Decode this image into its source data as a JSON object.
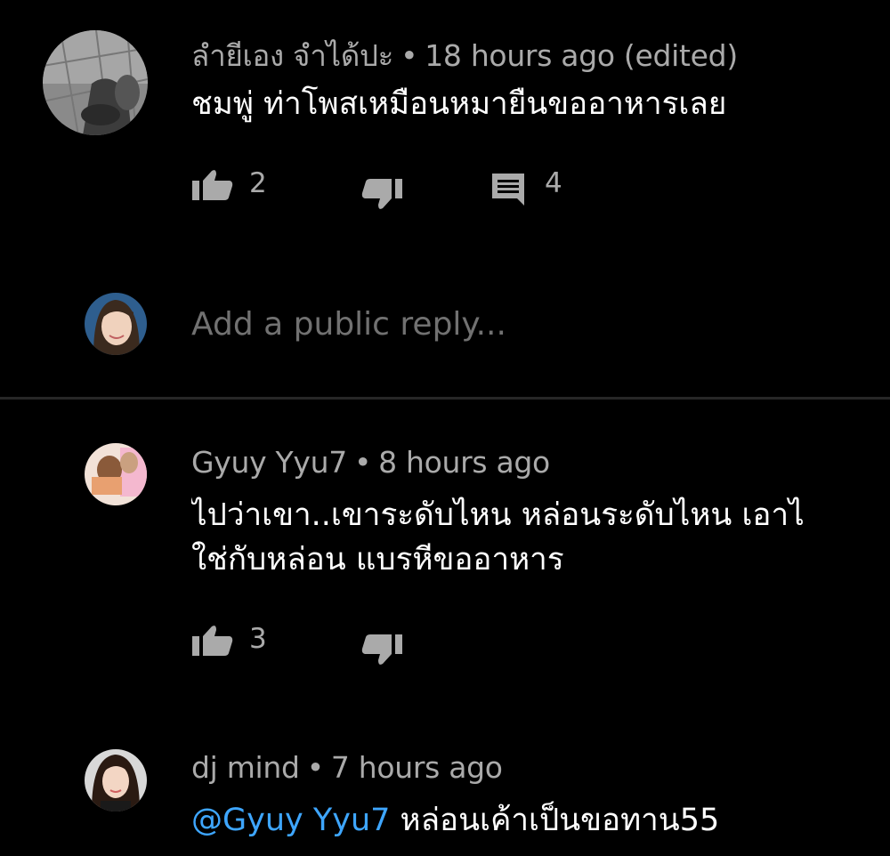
{
  "comment1": {
    "author": "ลำยีเอง จำได้ปะ",
    "separator": "•",
    "time": "18 hours ago (edited)",
    "text": "ชมพู่ ท่าโพสเหมือนหมายืนขออาหารเลย",
    "likes": "2",
    "replies": "4"
  },
  "reply_box": {
    "placeholder": "Add a public reply..."
  },
  "comment2": {
    "author": "Gyuy Yyu7",
    "separator": "•",
    "time": "8 hours ago",
    "text_line1": "ไปว่าเขา..เขาระดับไหน  หล่อนระดับไหน  เอาไ",
    "text_line2": "ใช่กับหล่อน  แบรหีขออาหาร",
    "likes": "3"
  },
  "comment3": {
    "author": "dj mind",
    "separator": "•",
    "time": "7 hours ago",
    "mention": "@Gyuy Yyu7",
    "text": " หล่อนเค้าเป็นขอทาน55"
  },
  "colors": {
    "background": "#000000",
    "meta_text": "#aaaaaa",
    "body_text": "#ffffff",
    "mention": "#3ea6ff",
    "divider": "#272727"
  },
  "icons": {
    "like": "thumbs-up-icon",
    "dislike": "thumbs-down-icon",
    "reply": "comment-icon"
  }
}
